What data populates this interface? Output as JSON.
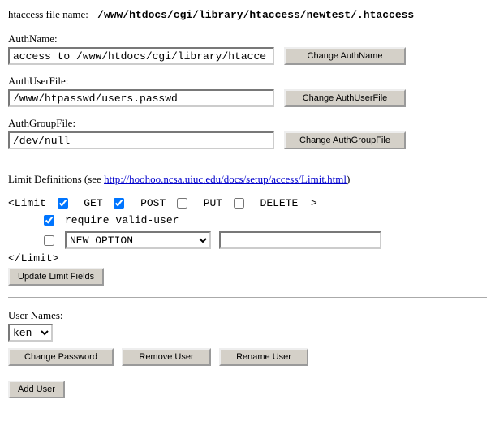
{
  "header": {
    "label": "htaccess file name:",
    "path": "/www/htdocs/cgi/library/htaccess/newtest/.htaccess"
  },
  "authname": {
    "label": "AuthName:",
    "value": "access to /www/htdocs/cgi/library/htacce",
    "button": "Change AuthName"
  },
  "authuserfile": {
    "label": "AuthUserFile:",
    "value": "/www/htpasswd/users.passwd",
    "button": "Change AuthUserFile"
  },
  "authgroupfile": {
    "label": "AuthGroupFile:",
    "value": "/dev/null",
    "button": "Change AuthGroupFile"
  },
  "limit": {
    "intro_prefix": "Limit Definitions (see ",
    "link_text": "http://hoohoo.ncsa.uiuc.edu/docs/setup/access/Limit.html",
    "intro_suffix": ")",
    "open_tag_start": "<Limit",
    "method_get": "GET",
    "method_post": "POST",
    "method_put": "PUT",
    "method_delete": "DELETE",
    "open_tag_end": ">",
    "require_label": "require valid-user",
    "new_option": "NEW OPTION",
    "new_option_value": "",
    "close_tag": "</Limit>",
    "update_button": "Update Limit Fields",
    "get_checked": true,
    "post_checked": true,
    "put_checked": false,
    "delete_checked": false,
    "require_checked": true,
    "newopt_checked": false
  },
  "users": {
    "label": "User Names:",
    "selected": "ken",
    "change_pw": "Change Password",
    "remove": "Remove User",
    "rename": "Rename User",
    "add": "Add User"
  }
}
